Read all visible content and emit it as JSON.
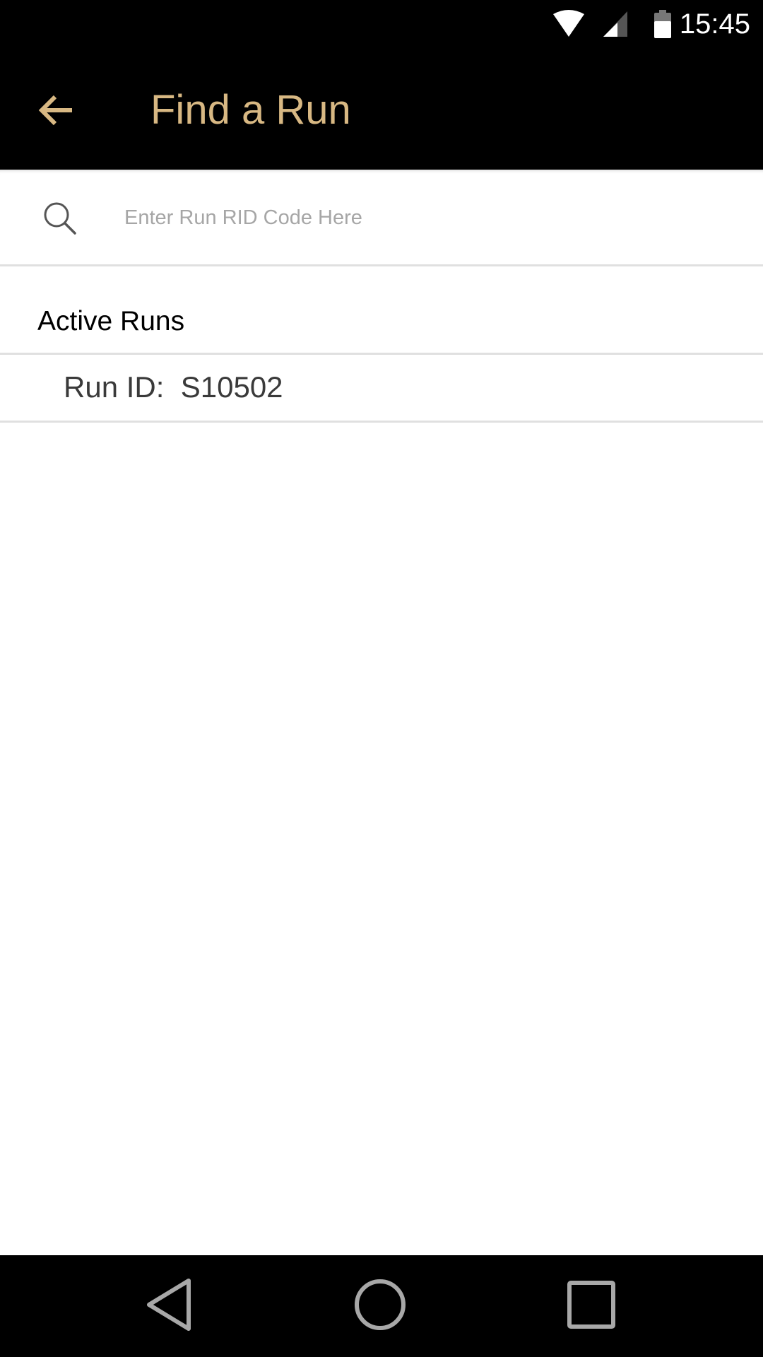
{
  "status_bar": {
    "time": "15:45",
    "icons": [
      "wifi-icon",
      "cell-signal-icon",
      "battery-icon"
    ]
  },
  "app_bar": {
    "title": "Find a Run",
    "back_icon": "arrow-left-icon"
  },
  "search": {
    "icon": "search-icon",
    "placeholder": "Enter Run RID Code Here",
    "value": ""
  },
  "active_runs": {
    "title": "Active Runs",
    "items": [
      {
        "label": "Run ID:  S10502"
      }
    ]
  },
  "nav_bar": {
    "icons": [
      "back-triangle-icon",
      "home-circle-icon",
      "recents-square-icon"
    ]
  },
  "colors": {
    "accent": "#d8b883",
    "bar_background": "#000000",
    "divider": "#e0e0e0",
    "placeholder": "#a6a6a6"
  }
}
